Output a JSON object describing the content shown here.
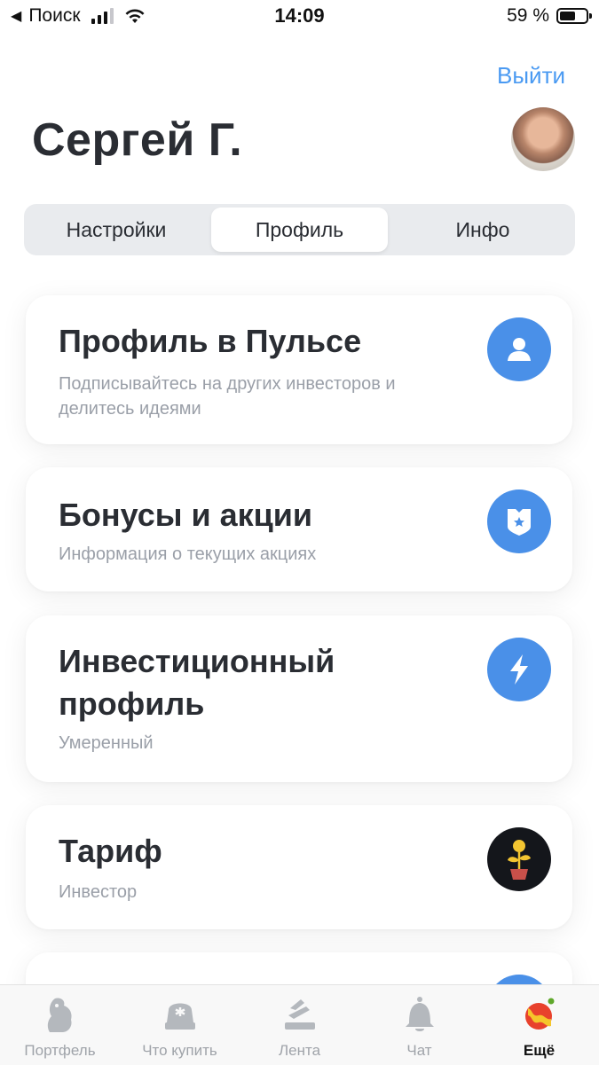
{
  "status_bar": {
    "back_label": "Поиск",
    "time": "14:09",
    "battery_text": "59 %",
    "battery_level": 0.59,
    "signal_bars": 3,
    "back_icon": "back-triangle-icon",
    "wifi_icon": "wifi-icon"
  },
  "header": {
    "logout_label": "Выйти",
    "user_name": "Сергей Г."
  },
  "segmented": {
    "tabs": [
      {
        "label": "Настройки"
      },
      {
        "label": "Профиль"
      },
      {
        "label": "Инфо"
      }
    ],
    "selected": "Профиль"
  },
  "cards": [
    {
      "title": "Профиль в Пульсе",
      "subtitle": "Подписывайтесь на других инвесторов и делитесь идеями",
      "icon": "person-icon"
    },
    {
      "title": "Бонусы и акции",
      "subtitle": "Информация о текущих акциях",
      "icon": "badge-star-icon"
    },
    {
      "title": "Инвестиционный профиль",
      "subtitle": "Умеренный",
      "icon": "lightning-icon"
    },
    {
      "title": "Тариф",
      "subtitle": "Инвестор",
      "icon": "money-plant-icon"
    }
  ],
  "tabbar": {
    "items": [
      {
        "label": "Портфель",
        "icon": "portfolio-icon"
      },
      {
        "label": "Что купить",
        "icon": "what-to-buy-icon"
      },
      {
        "label": "Лента",
        "icon": "feed-icon"
      },
      {
        "label": "Чат",
        "icon": "bell-icon"
      },
      {
        "label": "Ещё",
        "icon": "more-icon"
      }
    ],
    "active": "Ещё"
  },
  "colors": {
    "accent": "#4a9af2",
    "icon_blue": "#4a90e8",
    "text": "#2a2d33",
    "muted": "#9a9fa8"
  }
}
